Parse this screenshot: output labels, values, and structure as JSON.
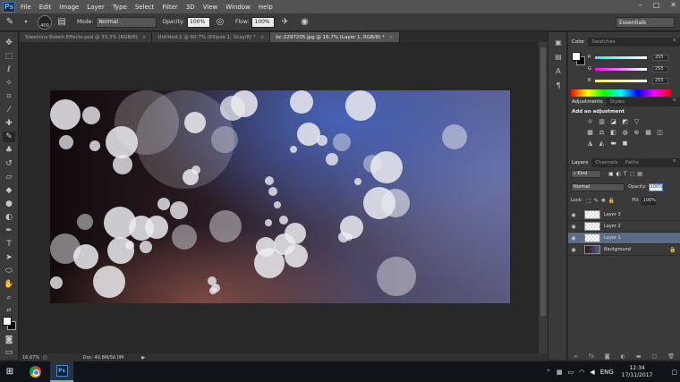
{
  "app": {
    "logo": "Ps",
    "menus": [
      "File",
      "Edit",
      "Image",
      "Layer",
      "Type",
      "Select",
      "Filter",
      "3D",
      "View",
      "Window",
      "Help"
    ],
    "window_controls": [
      "–",
      "□",
      "✕"
    ]
  },
  "options_bar": {
    "brush_size": "400",
    "mode_label": "Mode:",
    "mode_value": "Normal",
    "opacity_label": "Opacity:",
    "opacity_value": "100%",
    "flow_label": "Flow:",
    "flow_value": "100%",
    "workspace": "Essentials"
  },
  "tabs": [
    {
      "label": "Steelinns Bokeh Effects.psd @ 33.3% (RGB/8)",
      "active": false
    },
    {
      "label": "Untitled-1 @ 60.7% (Ellipse 1, Gray/8) *",
      "active": false
    },
    {
      "label": "bc-2297205.jpg @ 16.7% (Layer 1, RGB/8) *",
      "active": true
    }
  ],
  "status_bar": {
    "zoom": "16.67%",
    "doc": "Doc: 40.8M/56.0M"
  },
  "color_panel": {
    "tabs": [
      "Color",
      "Swatches"
    ],
    "channels": [
      {
        "label": "R",
        "value": "255",
        "gradient": "#ff0000"
      },
      {
        "label": "G",
        "value": "255",
        "gradient": "#00ff00"
      },
      {
        "label": "B",
        "value": "255",
        "gradient": "#0000ff"
      }
    ]
  },
  "adjustments_panel": {
    "tabs": [
      "Adjustments",
      "Styles"
    ],
    "title": "Add an adjustment"
  },
  "layers_panel": {
    "tabs": [
      "Layers",
      "Channels",
      "Paths"
    ],
    "kind_label": "Kind",
    "blend_mode": "Normal",
    "opacity_label": "Opacity:",
    "opacity_value": "100%",
    "lock_label": "Lock:",
    "fill_label": "Fill:",
    "fill_value": "100%",
    "layers": [
      {
        "name": "Layer 3",
        "selected": false,
        "background": false
      },
      {
        "name": "Layer 2",
        "selected": false,
        "background": false
      },
      {
        "name": "Layer 1",
        "selected": true,
        "background": false
      },
      {
        "name": "Background",
        "selected": false,
        "background": true
      }
    ],
    "footer_icons": [
      "link-icon",
      "fx-icon",
      "mask-icon",
      "adjustment-icon",
      "folder-icon",
      "new-layer-icon",
      "trash-icon"
    ]
  },
  "taskbar": {
    "language": "ENG",
    "time": "12:34",
    "date": "17/11/2017"
  }
}
